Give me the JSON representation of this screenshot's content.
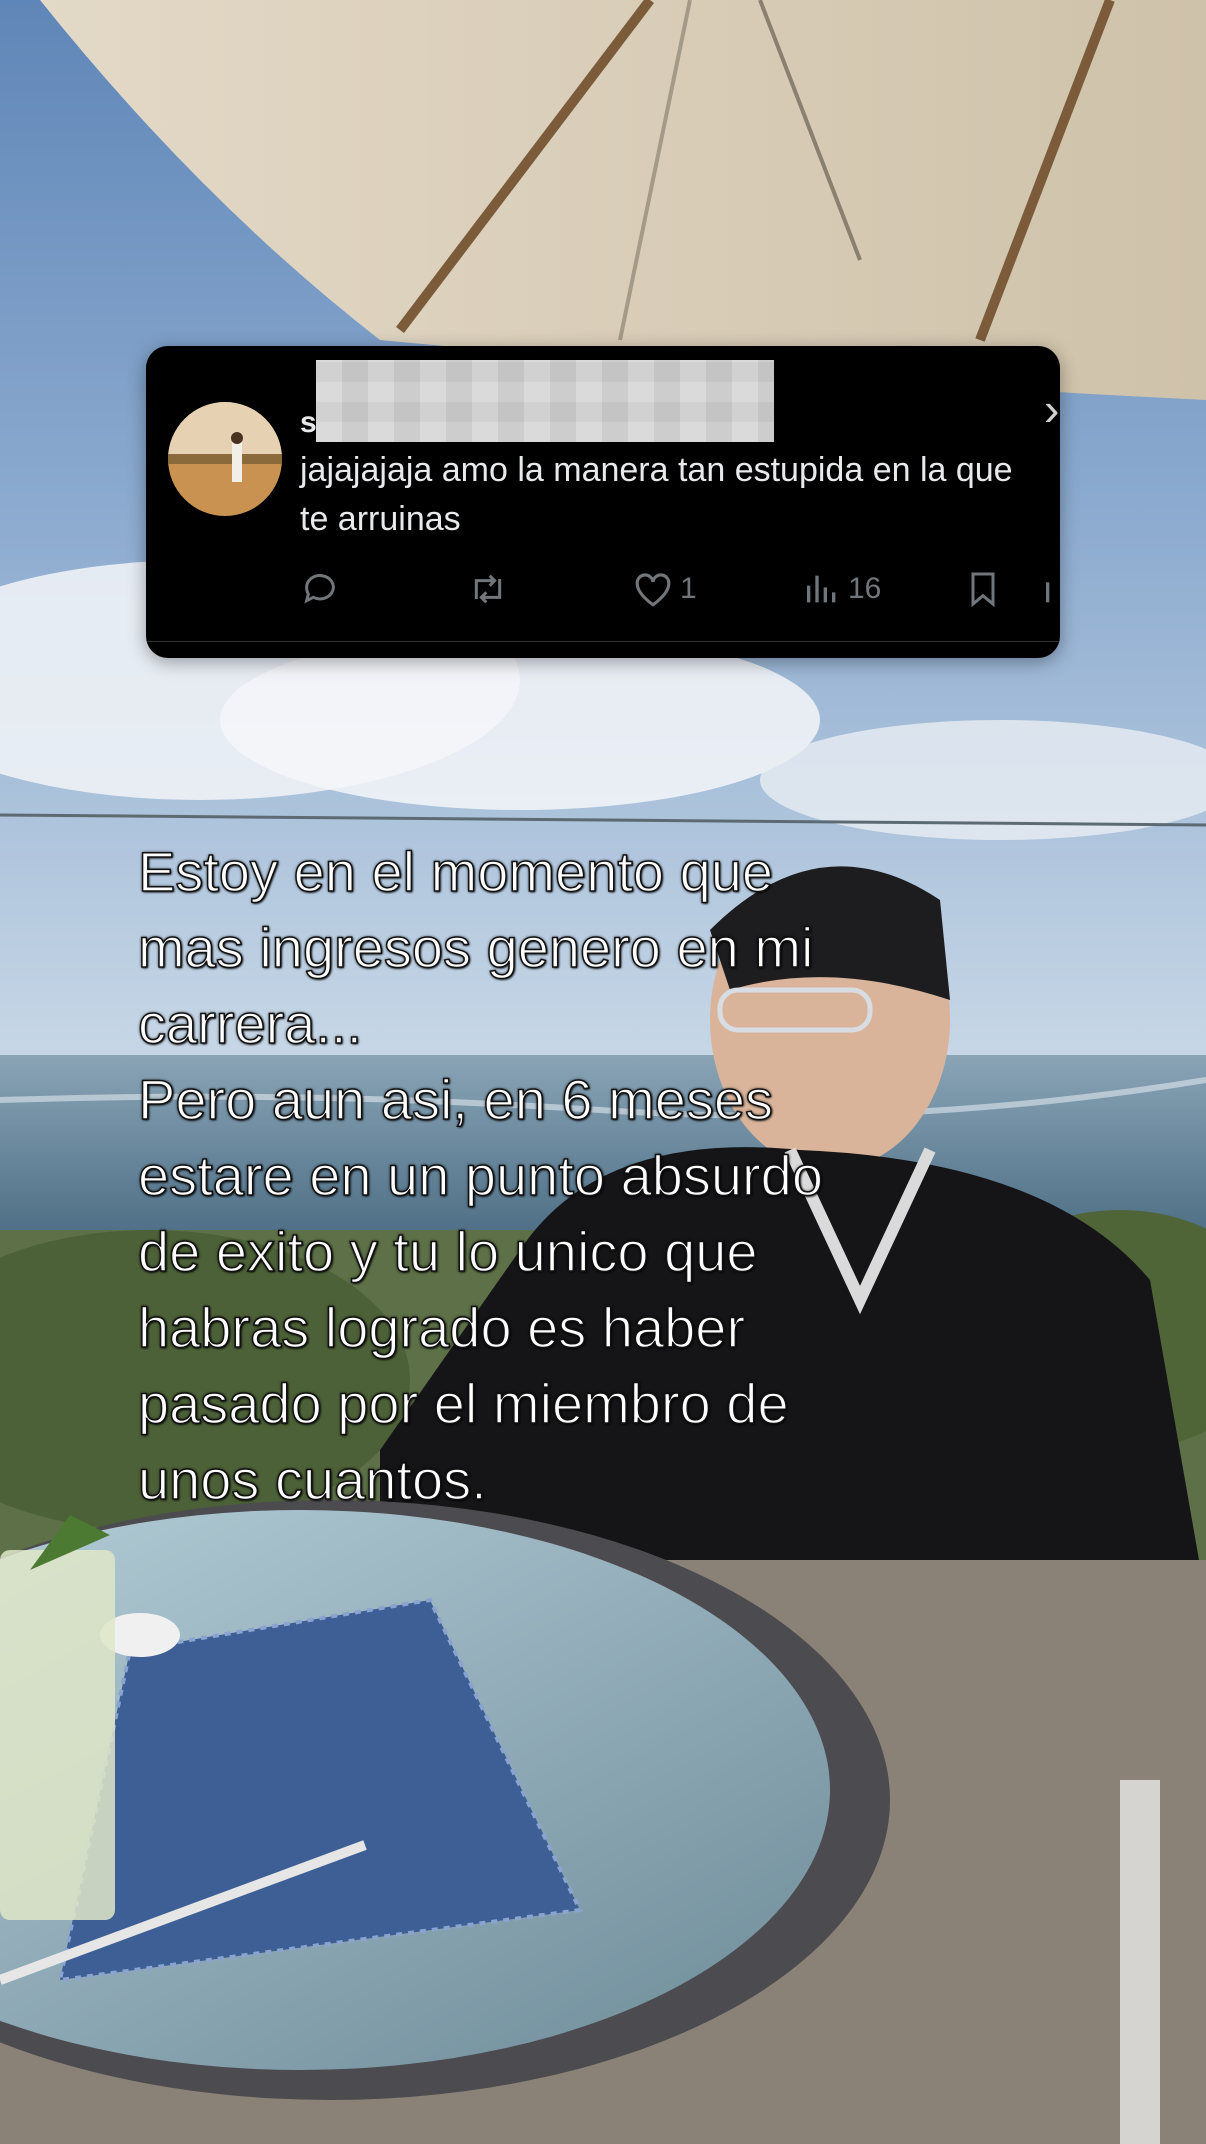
{
  "tweet": {
    "handle_initial": "s",
    "text": "jajajajaja amo la manera tan estupida en la que te arruinas",
    "likes": "1",
    "views": "16",
    "reply_icon": "reply-icon",
    "retweet_icon": "retweet-icon",
    "like_icon": "heart-icon",
    "views_icon": "views-icon",
    "bookmark_icon": "bookmark-icon"
  },
  "caption": "Estoy en el momento que\nmas ingresos genero en mi\ncarrera...\nPero aun asi, en 6 meses\nestare en un punto absurdo\nde exito y tu lo unico que\nhabras logrado es haber\npasado por el miembro de\nunos cuantos."
}
